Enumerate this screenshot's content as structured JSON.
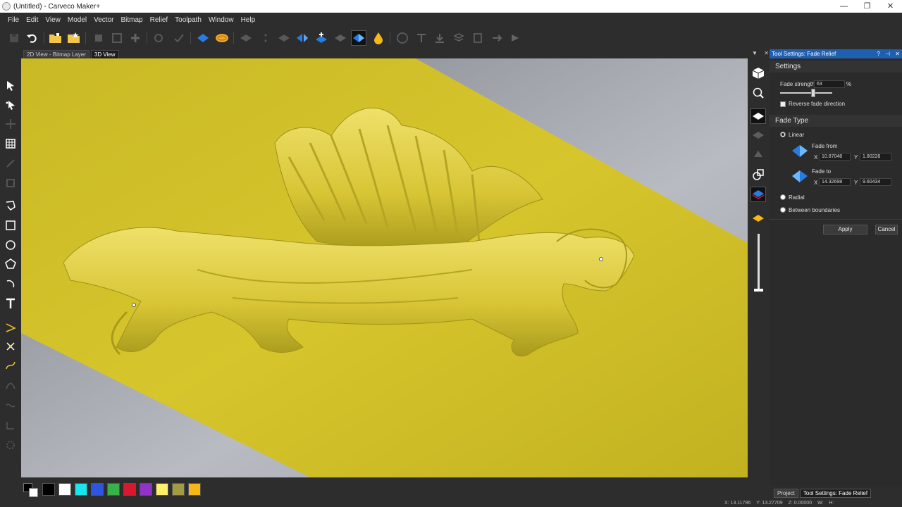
{
  "window": {
    "title": "(Untitled) - Carveco Maker+",
    "minimize": "—",
    "restore": "❐",
    "close": "✕"
  },
  "menu": [
    "File",
    "Edit",
    "View",
    "Model",
    "Vector",
    "Bitmap",
    "Relief",
    "Toolpath",
    "Window",
    "Help"
  ],
  "view_tabs": [
    {
      "label": "2D View - Bitmap Layer",
      "active": false
    },
    {
      "label": "3D View",
      "active": true
    }
  ],
  "panel": {
    "title": "Tool Settings: Fade Relief",
    "help": "?",
    "pin": "⊣",
    "close": "✕",
    "settings_heading": "Settings",
    "fade_strength_label": "Fade strength",
    "fade_strength_value": "63",
    "fade_strength_unit": "%",
    "fade_strength_slider": 0.63,
    "reverse_label": "Reverse fade direction",
    "reverse_checked": false,
    "fade_type_heading": "Fade Type",
    "linear_label": "Linear",
    "fade_from_label": "Fade from",
    "fade_from_x": "10.87048",
    "fade_from_y": "1.80228",
    "fade_to_label": "Fade to",
    "fade_to_x": "14.32698",
    "fade_to_y": "9.60434",
    "x_label": "X",
    "y_label": "Y",
    "radial_label": "Radial",
    "between_label": "Between boundaries",
    "selected_type": "Linear",
    "apply_label": "Apply",
    "cancel_label": "Cancel"
  },
  "viewport_controls": {
    "dropdown": "▼",
    "close": "✕"
  },
  "palette": [
    "#000000",
    "#ffffff",
    "#19e6ec",
    "#2f55e0",
    "#39b14a",
    "#d8182c",
    "#9232c9",
    "#ffef6b",
    "#a39b41",
    "#f5b816"
  ],
  "bottom_tabs": [
    {
      "label": "Project",
      "active": false
    },
    {
      "label": "Tool Settings: Fade Relief",
      "active": true
    }
  ],
  "status": {
    "x": "X: 13.11786",
    "y": "Y: 13.27709",
    "z": "Z: 0.00000",
    "w": "W:",
    "h": "H:"
  },
  "colors": {
    "relief_yellow": "#c8b822",
    "accent_blue": "#1f5fb0"
  }
}
